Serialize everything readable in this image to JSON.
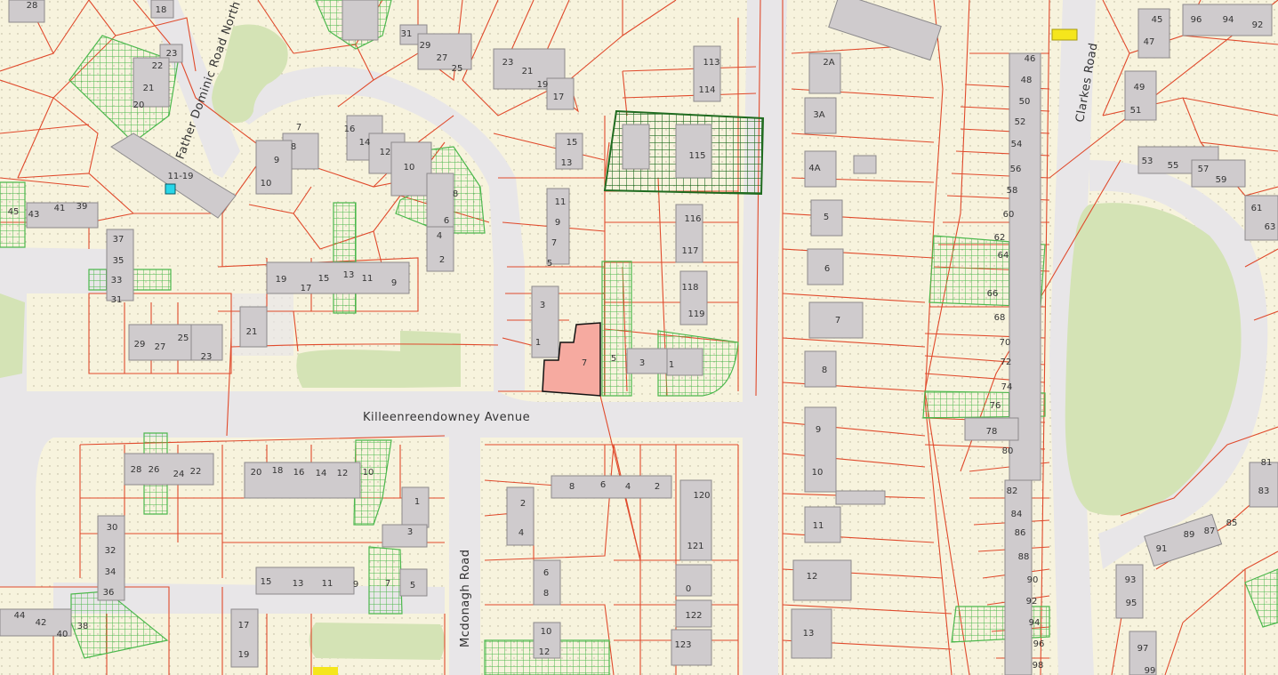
{
  "roads": {
    "killeenreendowney": "Killeenreendowney Avenue",
    "father_dominic": "Father Dominic Road North",
    "mcdonagh": "Mcdonagh Road",
    "clarkes": "Clarkes Road"
  },
  "colors": {
    "background": "#f7f3dd",
    "road": "#e8e6e8",
    "park": "#d4e3b5",
    "boundary": "#e04a2c",
    "building": "#cfcbcd",
    "selected_property": "#f6aaa0",
    "hatch_green": "#4db84d",
    "hatch_dark": "#1f6b1f",
    "marker_cyan": "#28d6e8",
    "marker_yellow": "#f5e61c"
  },
  "house_numbers": {
    "n28": "28",
    "n18": "18",
    "n23": "23",
    "n22": "22",
    "n21a": "21",
    "n20a": "20",
    "n31a": "31",
    "n29a": "29",
    "n27a": "27",
    "n25a": "25",
    "n23b": "23",
    "n21b": "21",
    "n19a": "19",
    "n17a": "17",
    "n11_19": "11-19",
    "n7a": "7",
    "n8a": "8",
    "n9a": "9",
    "n10a": "10",
    "n16a": "16",
    "n14a": "14",
    "n12a": "12",
    "n10b": "10",
    "n8b": "8",
    "n6b": "6",
    "n4b": "4",
    "n2b": "2",
    "n45a": "45",
    "n43a": "43",
    "n41a": "41",
    "n39a": "39",
    "n37c": "37",
    "n35c": "35",
    "n33c": "33",
    "n31c": "31",
    "n29c": "29",
    "n27c": "27",
    "n25c": "25",
    "n23c": "23",
    "n21c": "21",
    "n19d": "19",
    "n17d": "17",
    "n15d": "15",
    "n13d": "13",
    "n11d": "11",
    "n9d": "9",
    "n15e": "15",
    "n13e": "13",
    "n11e": "11",
    "n9e": "9",
    "n7e": "7",
    "n5e": "5",
    "n3e": "3",
    "n1e": "1",
    "n7sel": "7",
    "n5f": "5",
    "n3f": "3",
    "n1f": "1",
    "n113": "113",
    "n114": "114",
    "n115": "115",
    "n116": "116",
    "n117": "117",
    "n118": "118",
    "n119": "119",
    "n2A": "2A",
    "n3A": "3A",
    "n4A": "4A",
    "n5g": "5",
    "n6g": "6",
    "n7g": "7",
    "n8g": "8",
    "n9g": "9",
    "n10g": "10",
    "n11g": "11",
    "n12g": "12",
    "n13g": "13",
    "n46": "46",
    "n48": "48",
    "n50": "50",
    "n52": "52",
    "n54": "54",
    "n56": "56",
    "n58": "58",
    "n60": "60",
    "n62": "62",
    "n64": "64",
    "n66": "66",
    "n68": "68",
    "n70": "70",
    "n72": "72",
    "n74": "74",
    "n76": "76",
    "n78": "78",
    "n80": "80",
    "n82": "82",
    "n84": "84",
    "n86": "86",
    "n88": "88",
    "n90": "90",
    "n92": "92",
    "n94b": "94",
    "n96b": "96",
    "n98": "98",
    "n45h": "45",
    "n47h": "47",
    "n96h": "96",
    "n94h": "94",
    "n92h": "92",
    "n49h": "49",
    "n51h": "51",
    "n53h": "53",
    "n55h": "55",
    "n57h": "57",
    "n59h": "59",
    "n61h": "61",
    "n63h": "63",
    "n81": "81",
    "n83": "83",
    "n85": "85",
    "n87": "87",
    "n89": "89",
    "n91": "91",
    "n93": "93",
    "n95": "95",
    "n97": "97",
    "n99": "99",
    "n28i": "28",
    "n26i": "26",
    "n24i": "24",
    "n22i": "22",
    "n20i": "20",
    "n18i": "18",
    "n16i": "16",
    "n14i": "14",
    "n12i": "12",
    "n10i": "10",
    "n1j": "1",
    "n3j": "3",
    "n30j": "30",
    "n32j": "32",
    "n34j": "34",
    "n36j": "36",
    "n15k": "15",
    "n13k": "13",
    "n11k": "11",
    "n9k": "9",
    "n7k": "7",
    "n5k": "5",
    "n44": "44",
    "n42": "42",
    "n40": "40",
    "n38": "38",
    "n17m": "17",
    "n19m": "19",
    "n8n": "8",
    "n6n": "6",
    "n4n": "4",
    "n2n": "2",
    "n2o": "2",
    "n4o": "4",
    "n6o": "6",
    "n8o": "8",
    "n10o": "10",
    "n12o": "12",
    "n120": "120",
    "n121": "121",
    "n122": "122",
    "n123": "123",
    "n0": "0"
  }
}
